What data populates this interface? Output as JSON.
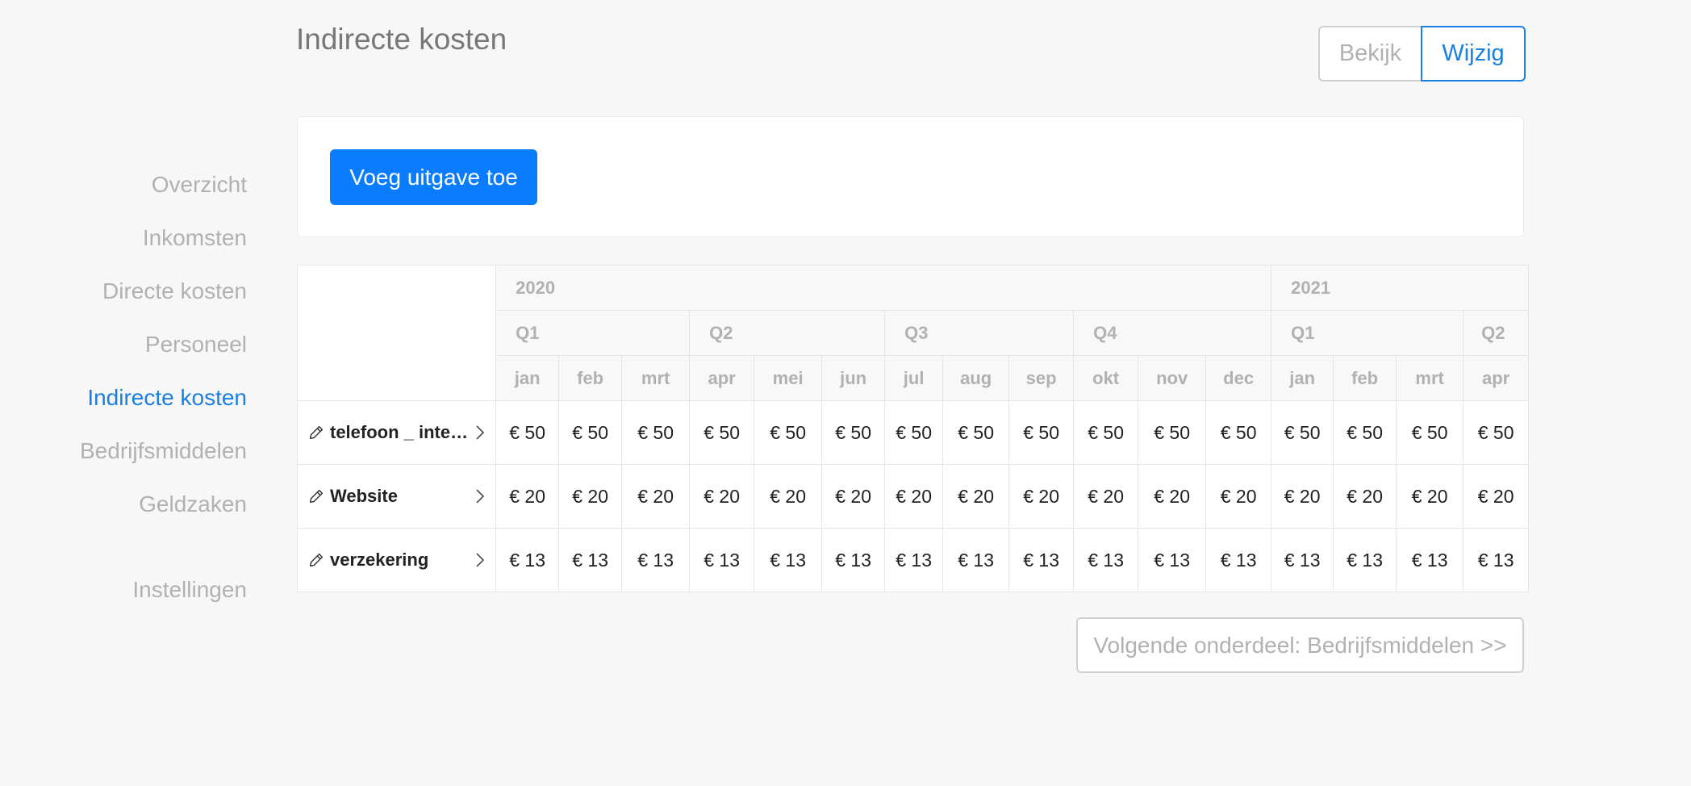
{
  "page": {
    "title": "Indirecte kosten"
  },
  "view_toggle": {
    "bekijk": "Bekijk",
    "wijzig": "Wijzig"
  },
  "sidebar": {
    "items": [
      {
        "label": "Overzicht",
        "active": false
      },
      {
        "label": "Inkomsten",
        "active": false
      },
      {
        "label": "Directe kosten",
        "active": false
      },
      {
        "label": "Personeel",
        "active": false
      },
      {
        "label": "Indirecte kosten",
        "active": true
      },
      {
        "label": "Bedrijfsmiddelen",
        "active": false
      },
      {
        "label": "Geldzaken",
        "active": false
      }
    ],
    "settings": "Instellingen"
  },
  "actions": {
    "add_expense": "Voeg uitgave toe",
    "next_section": "Volgende onderdeel: Bedrijfsmiddelen >>"
  },
  "table": {
    "years": [
      "2020",
      "2021"
    ],
    "quarters": [
      "Q1",
      "Q2",
      "Q3",
      "Q4",
      "Q1",
      "Q2"
    ],
    "months": [
      "jan",
      "feb",
      "mrt",
      "apr",
      "mei",
      "jun",
      "jul",
      "aug",
      "sep",
      "okt",
      "nov",
      "dec",
      "jan",
      "feb",
      "mrt",
      "apr"
    ],
    "rows": [
      {
        "label": "telefoon _ inte…",
        "values": [
          "€ 50",
          "€ 50",
          "€ 50",
          "€ 50",
          "€ 50",
          "€ 50",
          "€ 50",
          "€ 50",
          "€ 50",
          "€ 50",
          "€ 50",
          "€ 50",
          "€ 50",
          "€ 50",
          "€ 50",
          "€ 50"
        ]
      },
      {
        "label": "Website",
        "values": [
          "€ 20",
          "€ 20",
          "€ 20",
          "€ 20",
          "€ 20",
          "€ 20",
          "€ 20",
          "€ 20",
          "€ 20",
          "€ 20",
          "€ 20",
          "€ 20",
          "€ 20",
          "€ 20",
          "€ 20",
          "€ 20"
        ]
      },
      {
        "label": "verzekering",
        "values": [
          "€ 13",
          "€ 13",
          "€ 13",
          "€ 13",
          "€ 13",
          "€ 13",
          "€ 13",
          "€ 13",
          "€ 13",
          "€ 13",
          "€ 13",
          "€ 13",
          "€ 13",
          "€ 13",
          "€ 13",
          "€ 13"
        ]
      }
    ]
  },
  "colors": {
    "accent": "#0a7cff",
    "active_link": "#1a7fe0",
    "muted": "#b1b1b1",
    "background": "#f7f7f7"
  }
}
